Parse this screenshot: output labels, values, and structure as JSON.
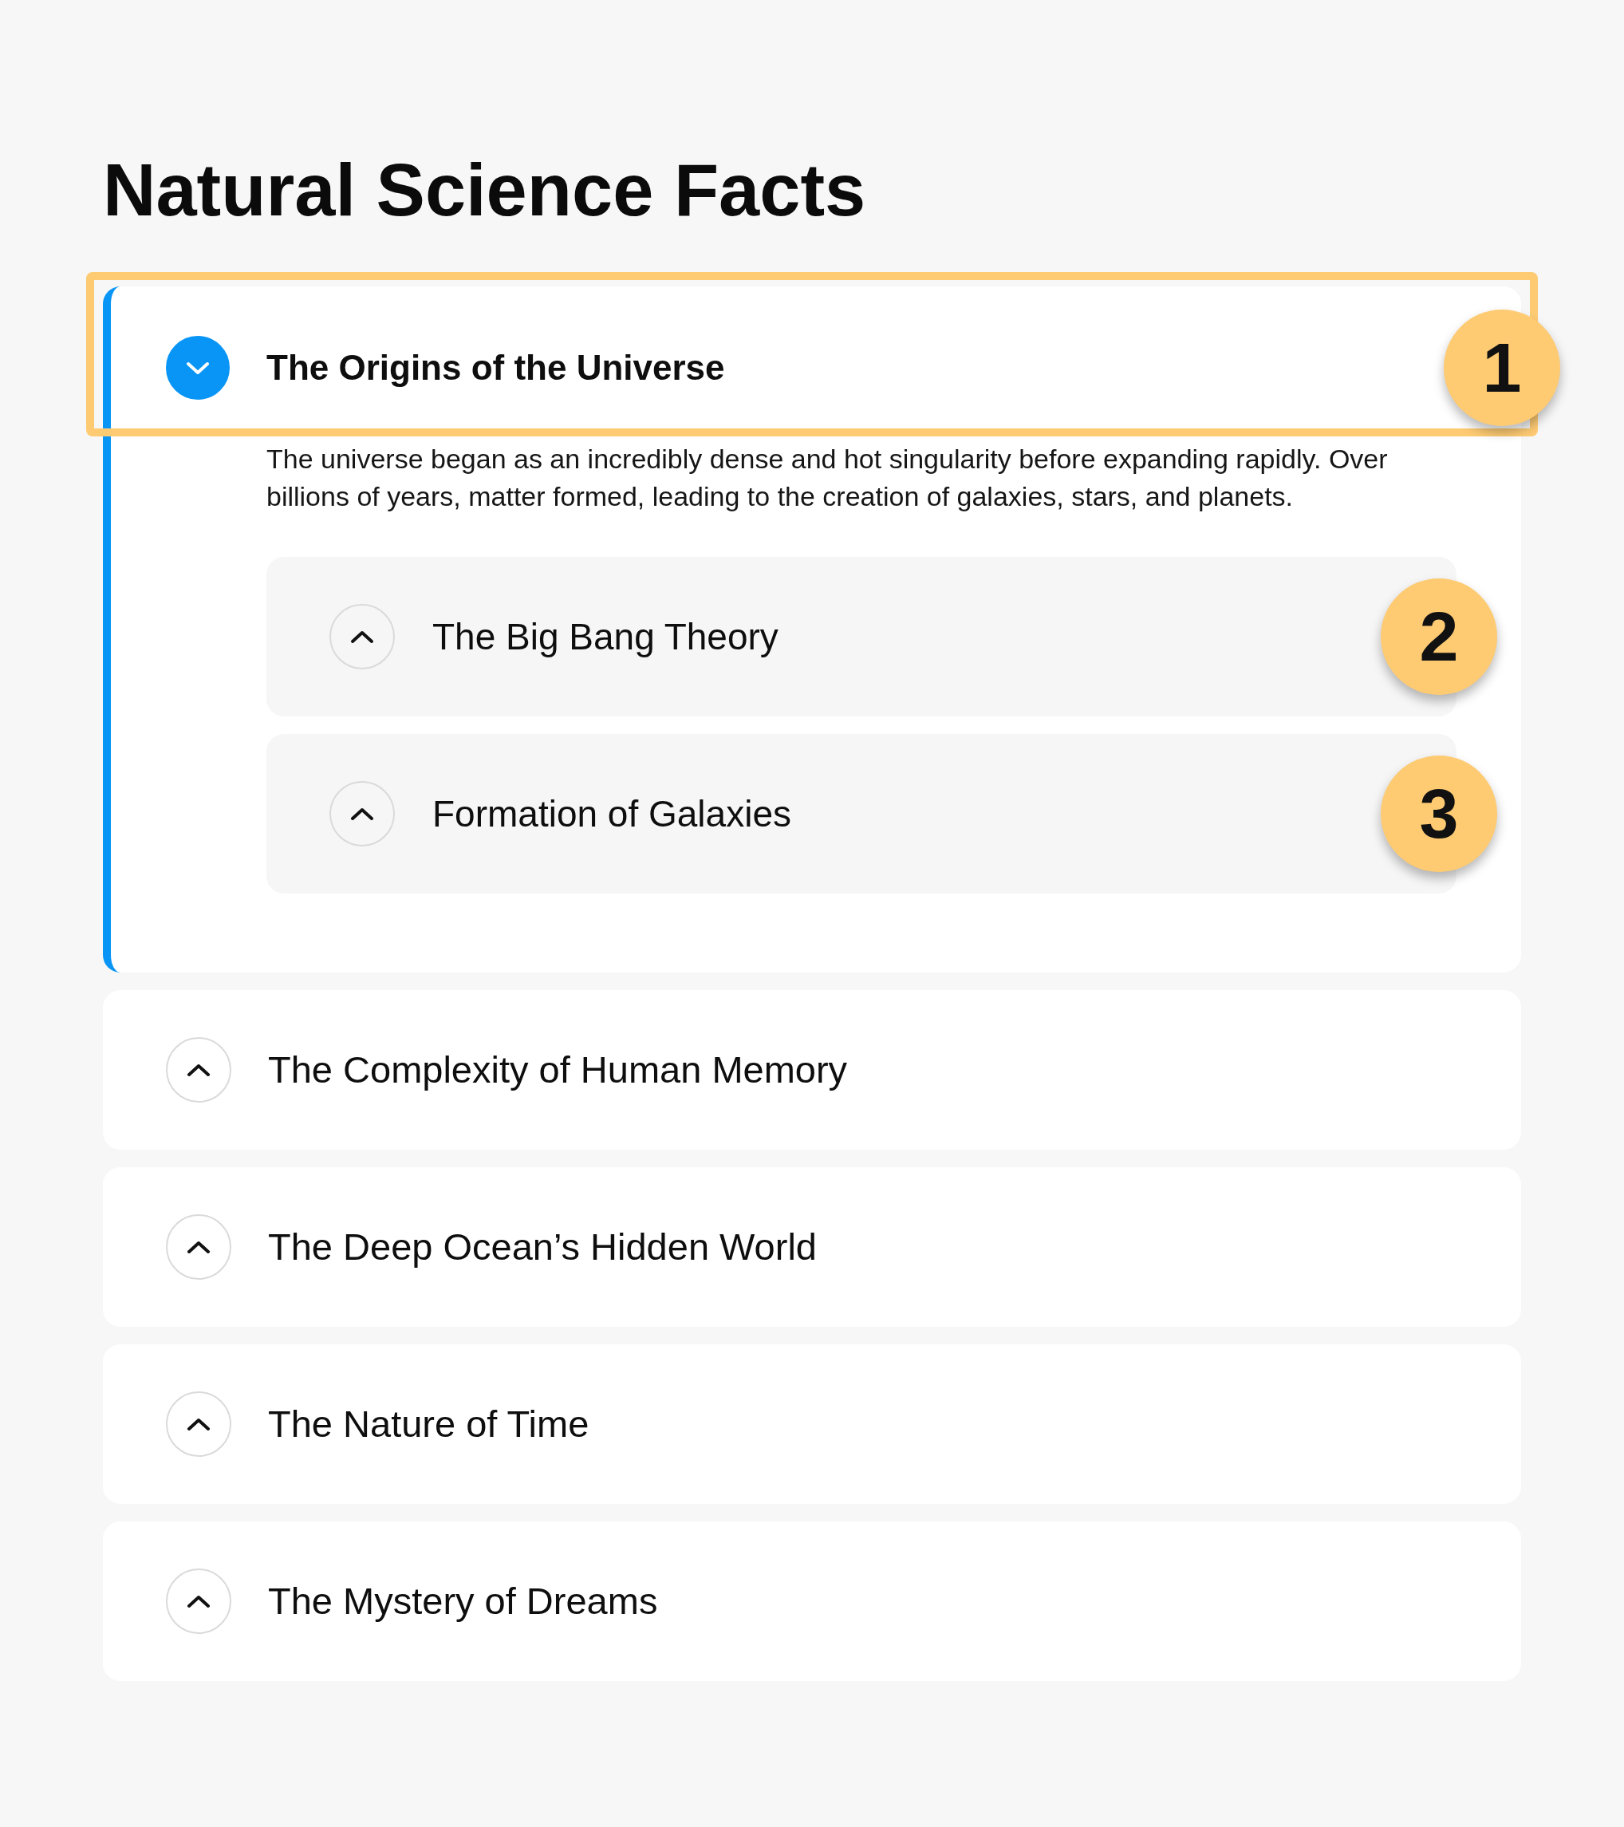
{
  "title": "Natural Science Facts",
  "topics": [
    {
      "title": "The Origins of the Universe",
      "expanded": true,
      "highlighted": true,
      "badge": "1",
      "body": "The universe began as an incredibly dense and hot singularity before expanding rapidly. Over billions of years, matter formed, leading to the creation of galaxies, stars, and planets.",
      "children": [
        {
          "title": "The Big Bang Theory",
          "expanded": false,
          "badge": "2"
        },
        {
          "title": "Formation of Galaxies",
          "expanded": false,
          "badge": "3"
        }
      ]
    },
    {
      "title": "The Complexity of Human Memory",
      "expanded": false,
      "highlighted": false
    },
    {
      "title": "The Deep Ocean’s Hidden World",
      "expanded": false,
      "highlighted": false
    },
    {
      "title": "The Nature of Time",
      "expanded": false,
      "highlighted": false
    },
    {
      "title": "The Mystery of Dreams",
      "expanded": false,
      "highlighted": false
    }
  ]
}
